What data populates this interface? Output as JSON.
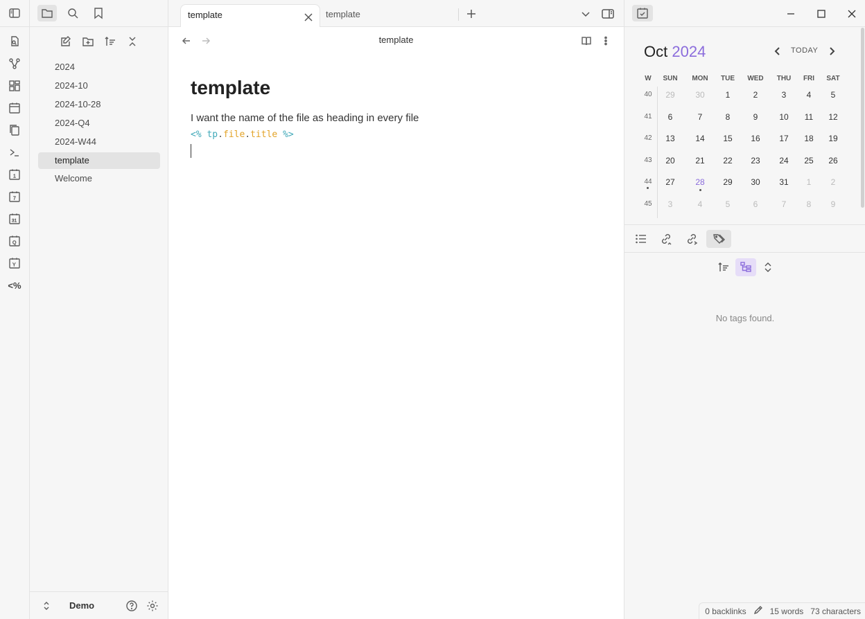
{
  "sidebar": {
    "files": [
      "2024",
      "2024-10",
      "2024-10-28",
      "2024-Q4",
      "2024-W44",
      "template",
      "Welcome"
    ],
    "active_file": "template",
    "vault_name": "Demo"
  },
  "ribbon": {
    "icons": [
      "switcher-icon",
      "graph-icon",
      "canvas-icon",
      "daily-note-icon",
      "copy-icon",
      "command-icon",
      "day-1-icon",
      "week-7-icon",
      "month-31-icon",
      "quarter-q-icon",
      "year-y-icon",
      "templater-icon"
    ],
    "templater_label": "<%"
  },
  "tabs": [
    {
      "label": "template",
      "active": true
    },
    {
      "label": "template",
      "active": false
    }
  ],
  "editor": {
    "view_title": "template",
    "heading": "template",
    "paragraph": "I want the name of the file as heading in every file",
    "code": {
      "open": "<%",
      "obj": "tp",
      "dot1": ".",
      "prop1": "file",
      "dot2": ".",
      "prop2": "title",
      "close": "%>"
    }
  },
  "calendar": {
    "month": "Oct",
    "year": "2024",
    "today_label": "TODAY",
    "week_header": "W",
    "day_headers": [
      "SUN",
      "MON",
      "TUE",
      "WED",
      "THU",
      "FRI",
      "SAT"
    ],
    "weeks": [
      {
        "week": "40",
        "days": [
          "29",
          "30",
          "1",
          "2",
          "3",
          "4",
          "5"
        ]
      },
      {
        "week": "41",
        "days": [
          "6",
          "7",
          "8",
          "9",
          "10",
          "11",
          "12"
        ]
      },
      {
        "week": "42",
        "days": [
          "13",
          "14",
          "15",
          "16",
          "17",
          "18",
          "19"
        ]
      },
      {
        "week": "43",
        "days": [
          "20",
          "21",
          "22",
          "23",
          "24",
          "25",
          "26"
        ]
      },
      {
        "week": "44",
        "days": [
          "27",
          "28",
          "29",
          "30",
          "31",
          "1",
          "2"
        ]
      },
      {
        "week": "45",
        "days": [
          "3",
          "4",
          "5",
          "6",
          "7",
          "8",
          "9"
        ]
      }
    ],
    "accent": "#8b6cdc"
  },
  "right_pane": {
    "empty_message": "No tags found."
  },
  "status_bar": {
    "backlinks": "0 backlinks",
    "words": "15 words",
    "characters": "73 characters"
  }
}
